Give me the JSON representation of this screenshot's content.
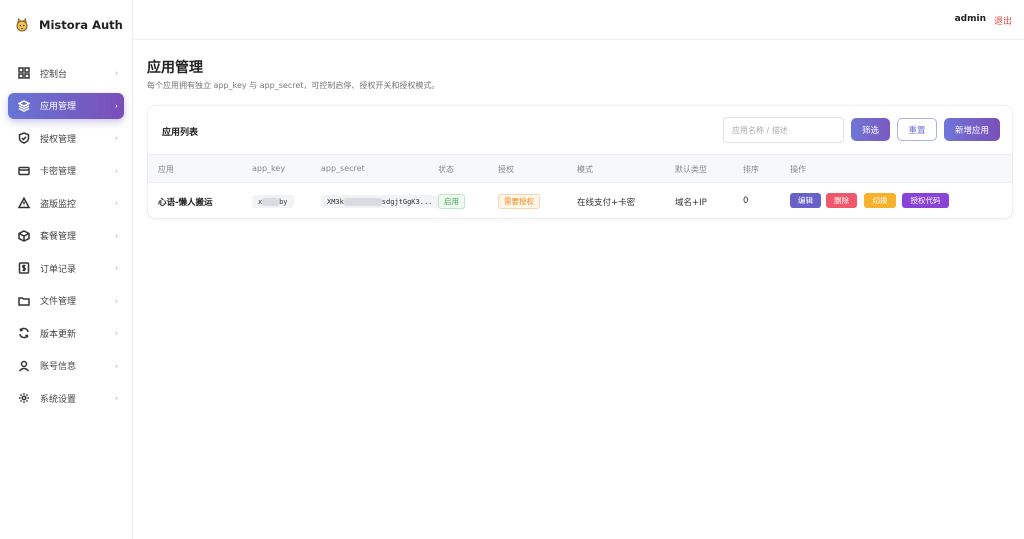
{
  "brand": {
    "name": "Mistora Auth",
    "logo_icon": "cat-logo-icon"
  },
  "sidebar": {
    "items": [
      {
        "label": "控制台",
        "icon": "grid-icon",
        "active": false
      },
      {
        "label": "应用管理",
        "icon": "layers-icon",
        "active": true
      },
      {
        "label": "授权管理",
        "icon": "shield-check-icon",
        "active": false
      },
      {
        "label": "卡密管理",
        "icon": "card-icon",
        "active": false
      },
      {
        "label": "盗版监控",
        "icon": "warning-icon",
        "active": false
      },
      {
        "label": "套餐管理",
        "icon": "box-icon",
        "active": false
      },
      {
        "label": "订单记录",
        "icon": "dollar-doc-icon",
        "active": false
      },
      {
        "label": "文件管理",
        "icon": "folder-icon",
        "active": false
      },
      {
        "label": "版本更新",
        "icon": "refresh-icon",
        "active": false
      },
      {
        "label": "账号信息",
        "icon": "user-icon",
        "active": false
      },
      {
        "label": "系统设置",
        "icon": "gear-icon",
        "active": false
      }
    ],
    "chevron": "›"
  },
  "topbar": {
    "user": "admin",
    "logout": "退出"
  },
  "page": {
    "title": "应用管理",
    "description": "每个应用拥有独立 app_key 与 app_secret，可控制启停、授权开关和授权模式。"
  },
  "card": {
    "title": "应用列表",
    "search_placeholder": "应用名称 / 描述",
    "filter_label": "筛选",
    "reset_label": "重置",
    "new_label": "新增应用"
  },
  "table": {
    "columns": [
      "应用",
      "app_key",
      "app_secret",
      "状态",
      "授权",
      "模式",
      "默认类型",
      "排序",
      "操作"
    ],
    "rows": [
      {
        "app": "心语-懒人搬运",
        "app_key_prefix": "x",
        "app_key_masked": "xxxx",
        "app_key_suffix": "by",
        "app_secret_prefix": "XM3k",
        "app_secret_masked": "xxxxxxxxx",
        "app_secret_suffix": "sdgjtGgK3...",
        "status": "启用",
        "auth": "需要授权",
        "mode": "在线支付+卡密",
        "default_type": "域名+IP",
        "sort": "0",
        "actions": {
          "edit": "编辑",
          "delete": "删除",
          "switch": "切换",
          "code": "授权代码"
        }
      }
    ]
  },
  "colors": {
    "accent_start": "#6875d6",
    "accent_end": "#7a4fb8",
    "danger": "#f0596b",
    "warning": "#f8b12b",
    "success": "#3aa655",
    "purple": "#8a43d8"
  }
}
